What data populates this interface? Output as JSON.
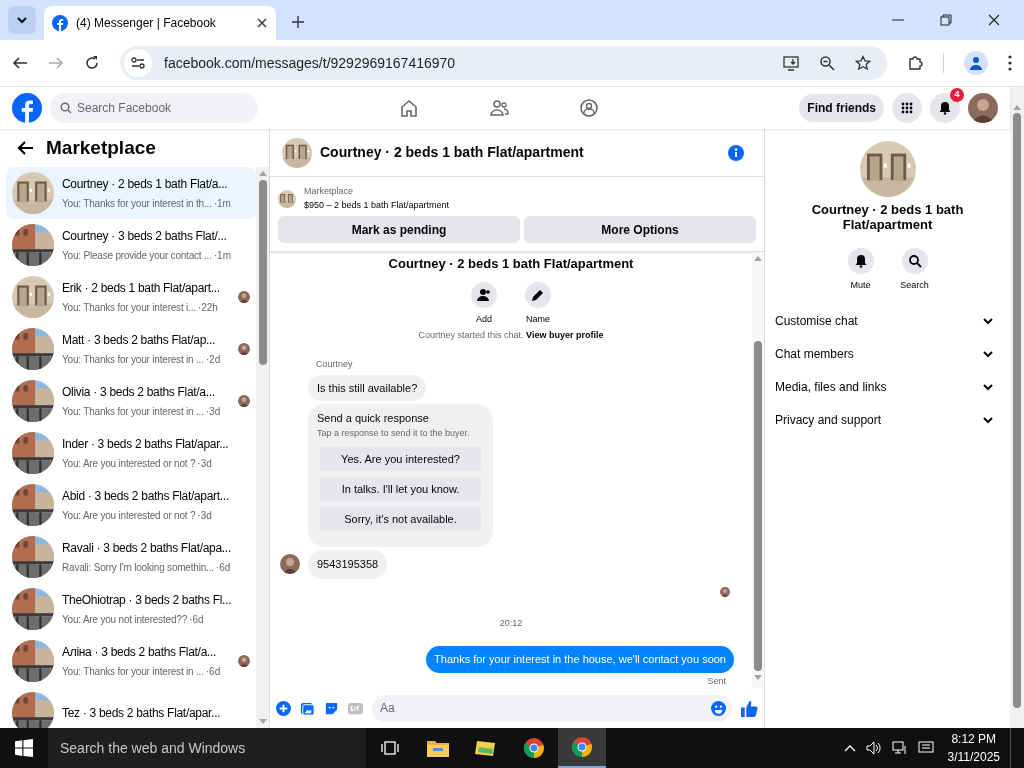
{
  "browser": {
    "tab_title": "(4) Messenger | Facebook",
    "url": "facebook.com/messages/t/9292969167416970"
  },
  "fb_header": {
    "search_placeholder": "Search Facebook",
    "find_friends": "Find friends",
    "notification_count": "4"
  },
  "sidebar": {
    "title": "Marketplace",
    "conversations": [
      {
        "name": "Courtney · 2 beds 1 bath Flat/a...",
        "preview": "You: Thanks for your interest in th...",
        "time": "·1m",
        "selected": true,
        "seen": false
      },
      {
        "name": "Courtney · 3 beds 2 baths Flat/...",
        "preview": "You: Please provide your contact ...",
        "time": "·1m",
        "selected": false,
        "seen": false
      },
      {
        "name": "Erik · 2 beds 1 bath Flat/apart...",
        "preview": "You: Thanks for your interest i...",
        "time": "·22h",
        "selected": false,
        "seen": true
      },
      {
        "name": "Matt · 3 beds 2 baths Flat/ap...",
        "preview": "You: Thanks for your interest in ...",
        "time": "·2d",
        "selected": false,
        "seen": true
      },
      {
        "name": "Olivia · 3 beds 2 baths Flat/a...",
        "preview": "You: Thanks for your interest in ...",
        "time": "·3d",
        "selected": false,
        "seen": true
      },
      {
        "name": "Inder · 3 beds 2 baths Flat/apar...",
        "preview": "You: Are you interested or not ?",
        "time": "·3d",
        "selected": false,
        "seen": false
      },
      {
        "name": "Abid · 3 beds 2 baths Flat/apart...",
        "preview": "You: Are you interested or not ?",
        "time": "·3d",
        "selected": false,
        "seen": false
      },
      {
        "name": "Ravali · 3 beds 2 baths Flat/apa...",
        "preview": "Ravali: Sorry I'm looking somethin...",
        "time": "·6d",
        "selected": false,
        "seen": false
      },
      {
        "name": "TheOhiotrap · 3 beds 2 baths Fl...",
        "preview": "You: Are you not interested??",
        "time": "·6d",
        "selected": false,
        "seen": false
      },
      {
        "name": "Аліна · 3 beds 2 baths Flat/a...",
        "preview": "You: Thanks for your interest in ...",
        "time": "·6d",
        "selected": false,
        "seen": true
      },
      {
        "name": "Tez · 3 beds 2 baths Flat/apar...",
        "selected": false,
        "seen": false
      }
    ]
  },
  "chat": {
    "title": "Courtney · 2 beds 1 bath Flat/apartment",
    "listing": {
      "label": "Marketplace",
      "title": "$950 – 2 beds 1 bath Flat/apartment"
    },
    "actions": [
      "Mark as pending",
      "More Options"
    ],
    "intro_title": "Courtney · 2 beds 1 bath Flat/apartment",
    "intro_actions": [
      {
        "kind": "add",
        "label": "Add"
      },
      {
        "kind": "name",
        "label": "Name"
      }
    ],
    "messages": [
      {
        "kind": "system",
        "text": "Courtney started this chat.",
        "link": "View buyer profile"
      },
      {
        "kind": "sender",
        "text": "Courtney"
      },
      {
        "kind": "incoming",
        "text": "Is this still available?"
      },
      {
        "kind": "quick_response",
        "title": "Send a quick response",
        "subtitle": "Tap a response to send it to the buyer.",
        "options": [
          "Yes. Are you interested?",
          "In talks. I'll let you know.",
          "Sorry, it's not available."
        ]
      },
      {
        "kind": "incoming_avatar",
        "text": "9543195358"
      },
      {
        "kind": "read_receipt"
      },
      {
        "kind": "timestamp",
        "text": "20:12"
      },
      {
        "kind": "outgoing",
        "text": "Thanks for your interest in the house, we'll contact you soon"
      },
      {
        "kind": "status",
        "text": "Sent"
      }
    ],
    "composer": {
      "placeholder": "Aa"
    }
  },
  "details": {
    "title": "Courtney · 2 beds 1 bath Flat/apartment",
    "actions": [
      {
        "kind": "mute",
        "label": "Mute"
      },
      {
        "kind": "search",
        "label": "Search"
      }
    ],
    "sections": [
      "Customise chat",
      "Chat members",
      "Media, files and links",
      "Privacy and support"
    ]
  },
  "taskbar": {
    "search_placeholder": "Search the web and Windows",
    "time": "8:12 PM",
    "date": "3/11/2025"
  }
}
